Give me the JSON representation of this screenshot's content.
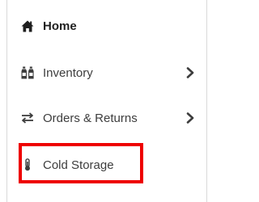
{
  "sidebar": {
    "items": [
      {
        "label": "Home",
        "icon": "home-icon",
        "active": true,
        "expandable": false
      },
      {
        "label": "Inventory",
        "icon": "bottles-icon",
        "active": false,
        "expandable": true
      },
      {
        "label": "Orders & Returns",
        "icon": "exchange-arrows-icon",
        "active": false,
        "expandable": true
      },
      {
        "label": "Cold Storage",
        "icon": "thermometer-icon",
        "active": false,
        "expandable": false,
        "highlighted": true
      }
    ]
  },
  "colors": {
    "highlight": "#ee0000",
    "text": "#3d3d3d",
    "border": "#d9d9d9"
  }
}
